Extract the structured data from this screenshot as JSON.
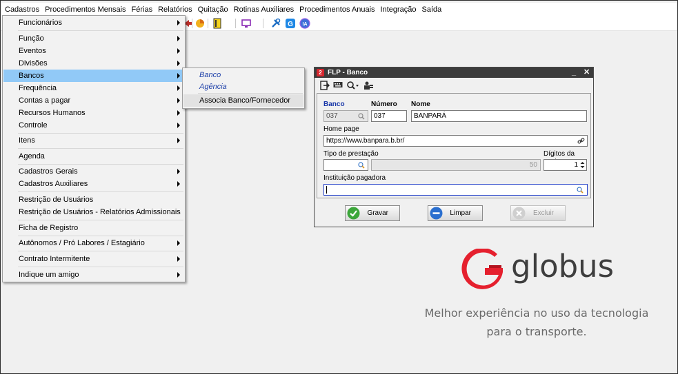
{
  "menubar": {
    "items": [
      "Cadastros",
      "Procedimentos Mensais",
      "Férias",
      "Relatórios",
      "Quitação",
      "Rotinas Auxiliares",
      "Procedimentos Anuais",
      "Integração",
      "Saída"
    ]
  },
  "cadastros_menu": {
    "items": [
      {
        "label": "Funcionários",
        "submenu": true
      },
      {
        "label": "Função",
        "submenu": true
      },
      {
        "label": "Eventos",
        "submenu": true
      },
      {
        "label": "Divisões",
        "submenu": true
      },
      {
        "label": "Bancos",
        "submenu": true,
        "selected": true
      },
      {
        "label": "Frequência",
        "submenu": true
      },
      {
        "label": "Contas a pagar",
        "submenu": true
      },
      {
        "label": "Recursos Humanos",
        "submenu": true
      },
      {
        "label": "Controle",
        "submenu": true
      },
      {
        "label": "Itens",
        "submenu": true
      },
      {
        "label": "Agenda",
        "submenu": false
      },
      {
        "label": "Cadastros Gerais",
        "submenu": true
      },
      {
        "label": "Cadastros Auxiliares",
        "submenu": true
      },
      {
        "label": "Restrição de Usuários",
        "submenu": false
      },
      {
        "label": "Restrição de Usuários - Relatórios Admissionais",
        "submenu": false
      },
      {
        "label": "Ficha de Registro",
        "submenu": false
      },
      {
        "label": "Autônomos / Pró Labores / Estagiário",
        "submenu": true
      },
      {
        "label": "Contrato Intermitente",
        "submenu": true
      },
      {
        "label": "Indique um amigo",
        "submenu": true
      }
    ]
  },
  "bancos_submenu": {
    "items": [
      "Banco",
      "Agência",
      "Associa Banco/Fornecedor"
    ]
  },
  "flp_window": {
    "title": "FLP - Banco",
    "logo_letter": "2",
    "minimize": "_",
    "close": "✕",
    "labels": {
      "banco": "Banco",
      "numero": "Número",
      "nome": "Nome",
      "home_page": "Home page",
      "tipo_prestacao": "Tipo de prestação",
      "digitos_conta": "Dígitos da conta",
      "instituicao_pagadora": "Instituição pagadora"
    },
    "values": {
      "banco": "037",
      "numero": "037",
      "nome": "BANPARÁ",
      "home_page": "https://www.banpara.b.br/",
      "tipo_prestacao": "",
      "tipo_prestacao_desc": "50",
      "digitos_conta": "1",
      "instituicao_pagadora": ""
    },
    "buttons": {
      "gravar": "Gravar",
      "limpar": "Limpar",
      "excluir": "Excluir"
    }
  },
  "branding": {
    "brand_name": "globus",
    "tagline_line1": "Melhor experiência no uso da tecnologia",
    "tagline_line2": "para o transporte.",
    "accent": "#e5202e"
  },
  "colors": {
    "menu_selected": "#91c9f7",
    "link_blue": "#1c3fa8",
    "title_bar": "#3c3c3c"
  }
}
